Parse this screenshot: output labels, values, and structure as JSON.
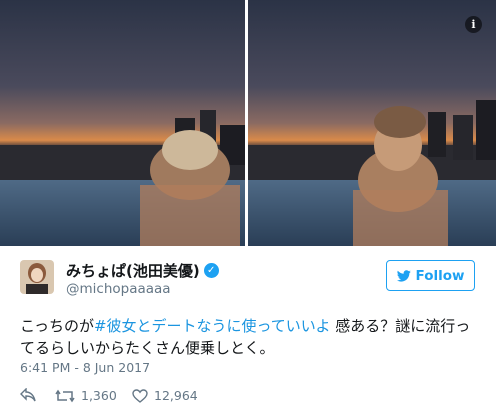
{
  "user": {
    "display_name": "みちょぱ(池田美優)",
    "handle": "@michopaaaaa",
    "verified": true
  },
  "follow_button": {
    "label": "Follow"
  },
  "tweet": {
    "text_before": "こっちのが",
    "hashtag": "#彼女とデートなうに使っていいよ",
    "text_after": " 感ある？謎に流行ってるらしいからたくさん便乗しとく。",
    "timestamp": "6:41 PM - 8 Jun 2017"
  },
  "stats": {
    "retweets": "1,360",
    "likes": "12,964"
  },
  "icons": {
    "info": "info-icon",
    "verified": "verified-badge-icon",
    "bird": "bird-icon",
    "reply": "reply-icon",
    "retweet": "retweet-icon",
    "like": "heart-icon"
  },
  "colors": {
    "accent": "#1da1f2",
    "hashtag": "#1b95e0",
    "muted": "#657786",
    "text": "#14171a"
  }
}
